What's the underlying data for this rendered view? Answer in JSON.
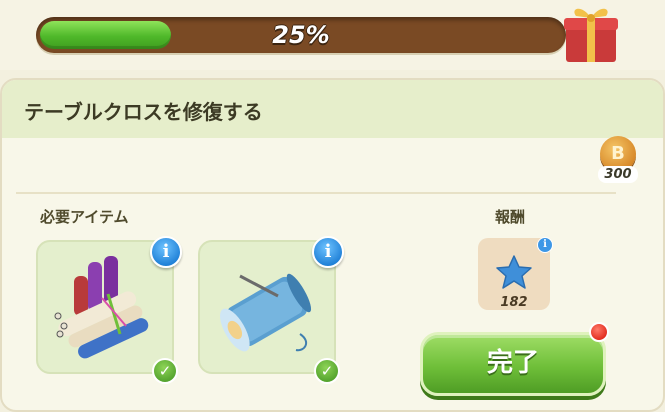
{
  "progress": {
    "percent_text": "25%",
    "fraction": 0.25
  },
  "card": {
    "title": "テーブルクロスを修復する",
    "coin_amount": "300",
    "coin_letter": "B",
    "required_label": "必要アイテム",
    "reward_label": "報酬",
    "required_items": [
      {
        "name": "fabric-bolts",
        "checked": true
      },
      {
        "name": "thread-spool",
        "checked": true
      }
    ],
    "reward": {
      "amount": "182",
      "icon": "blue-star-icon"
    },
    "complete_label": "完了"
  },
  "icons": {
    "info_glyph": "i",
    "check_glyph": "✓"
  },
  "colors": {
    "progress_track": "#7a4a24",
    "progress_fill": "#4fb82a",
    "header_bg": "#e6eecb",
    "complete_button": "#6fbf39",
    "info_blue": "#1e7fd6",
    "notify_red": "#e12a1c"
  }
}
